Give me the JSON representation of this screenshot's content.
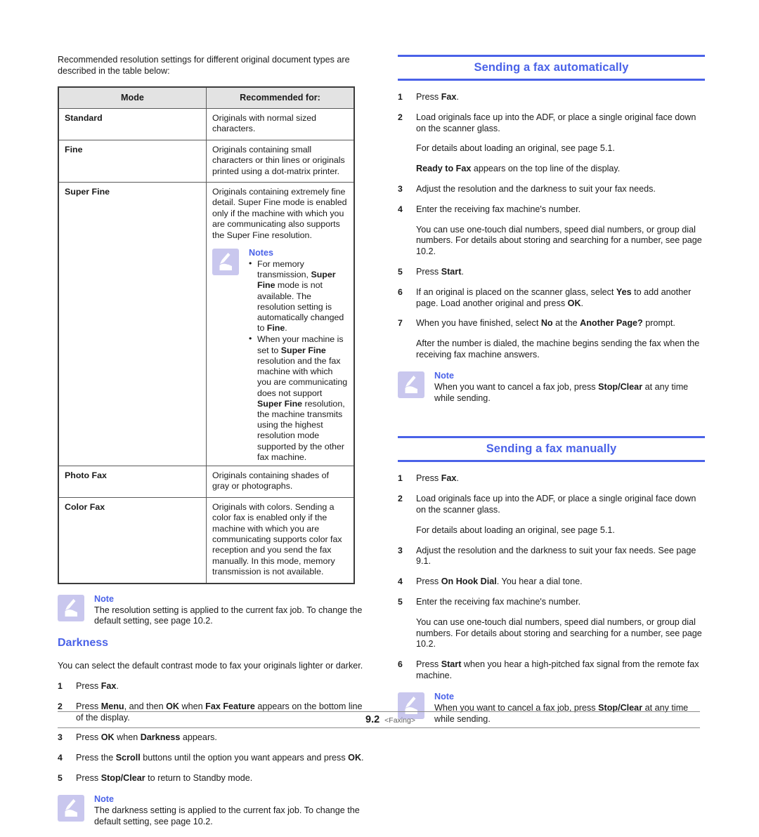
{
  "colors": {
    "heading_blue": "#4a62e8",
    "note_icon_bg": "#c9c7ee",
    "table_header_bg": "#e3e3e3",
    "text": "#1a1a1a"
  },
  "left_column": {
    "intro": "Recommended resolution settings for different original document types are described in the table below:",
    "table": {
      "headers": [
        "Mode",
        "Recommended for:"
      ],
      "rows": [
        {
          "mode": "Standard",
          "desc": "Originals with normal sized characters."
        },
        {
          "mode": "Fine",
          "desc": "Originals containing small characters or thin lines or originals printed using a dot-matrix printer."
        },
        {
          "mode": "Super Fine",
          "desc": "Originals containing extremely fine detail. Super Fine mode is enabled only if the machine with which you are communicating also supports the Super Fine resolution.",
          "note": {
            "icon": "note-hand-icon",
            "title": "Notes",
            "bullets": [
              "For memory transmission, Super Fine mode is not available. The resolution setting is automatically changed to Fine.",
              "When your machine is set to Super Fine resolution and the fax machine with which you are communicating does not support Super Fine resolution, the machine transmits using the highest resolution mode supported by the other fax machine."
            ]
          }
        },
        {
          "mode": "Photo Fax",
          "desc": "Originals containing shades of gray or photographs."
        },
        {
          "mode": "Color Fax",
          "desc": "Originals with colors. Sending a color fax is enabled only if the machine with which you are communicating supports color fax reception and you send the fax manually. In this mode, memory transmission is not available."
        }
      ]
    },
    "note_resolution": {
      "icon": "note-hand-icon",
      "title": "Note",
      "body": "The resolution setting is applied to the current fax job. To change the default setting, see page 10.2."
    },
    "darkness": {
      "heading": "Darkness",
      "intro": "You can select the default contrast mode to fax your originals lighter or darker.",
      "steps": [
        {
          "num": "1",
          "text": "Press Fax."
        },
        {
          "num": "2",
          "text": "Press Menu, and then OK when Fax Feature appears on the bottom line of the display."
        },
        {
          "num": "3",
          "text": "Press OK when Darkness appears."
        },
        {
          "num": "4",
          "text": "Press the Scroll buttons until the option you want appears and press OK."
        },
        {
          "num": "5",
          "text": "Press Stop/Clear to return to Standby mode."
        }
      ],
      "note": {
        "icon": "note-hand-icon",
        "title": "Note",
        "body": "The darkness setting is applied to the current fax job. To change the default setting, see page 10.2."
      }
    }
  },
  "right_column": {
    "auto_section": {
      "heading": "Sending a fax automatically",
      "steps": [
        {
          "num": "1",
          "text": "Press Fax."
        },
        {
          "num": "2",
          "text": "Load originals face up into the ADF, or place a single original face down on the scanner glass."
        },
        {
          "num": "3",
          "text": "Adjust the resolution and the darkness to suit your fax needs."
        },
        {
          "num": "4",
          "text": "Enter the receiving fax machine's number."
        },
        {
          "num": "5",
          "text": "Press Start."
        },
        {
          "num": "6",
          "text": "If an original is placed on the scanner glass, select Yes to add another page. Load another original and press OK."
        },
        {
          "num": "7",
          "text": "When you have finished, select No at the Another Page? prompt."
        }
      ],
      "sub_2a": "For details about loading an original, see page 5.1.",
      "sub_2b": "Ready to Fax appears on the top line of the display.",
      "sub_4": "You can use one-touch dial numbers, speed dial numbers, or group dial numbers. For details about storing and searching for a number, see page 10.2.",
      "sub_7": "After the number is dialed, the machine begins sending the fax when the receiving fax machine answers.",
      "note": {
        "icon": "note-hand-icon",
        "title": "Note",
        "body": "When you want to cancel a fax job, press Stop/Clear at any time while sending."
      }
    },
    "manual_section": {
      "heading": "Sending a fax manually",
      "steps": [
        {
          "num": "1",
          "text": "Press Fax."
        },
        {
          "num": "2",
          "text": "Load originals face up into the ADF, or place a single original face down on the scanner glass."
        },
        {
          "num": "3",
          "text": "Adjust the resolution and the darkness to suit your fax needs. See page 9.1."
        },
        {
          "num": "4",
          "text": "Press On Hook Dial. You hear a dial tone."
        },
        {
          "num": "5",
          "text": "Enter the receiving fax machine's number."
        },
        {
          "num": "6",
          "text": "Press Start when you hear a high-pitched fax signal from the remote fax machine."
        }
      ],
      "sub_2": "For details about loading an original, see page 5.1.",
      "sub_5": "You can use one-touch dial numbers, speed dial numbers, or group dial numbers. For details about storing and searching for a number, see page 10.2.",
      "note": {
        "icon": "note-hand-icon",
        "title": "Note",
        "body": "When you want to cancel a fax job, press Stop/Clear at any time while sending."
      }
    }
  },
  "footer": {
    "page_number": "9.2",
    "chapter": "<Faxing>"
  }
}
